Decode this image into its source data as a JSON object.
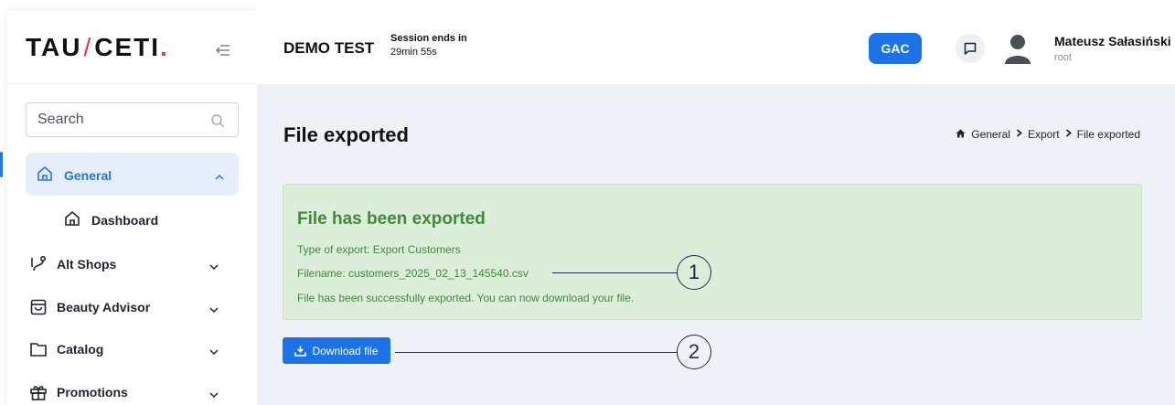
{
  "brand": {
    "logo_left": "TAU",
    "logo_slash": "/",
    "logo_right": "CETI",
    "logo_dot": "."
  },
  "sidebar": {
    "search_placeholder": "Search",
    "items": [
      {
        "label": "General",
        "icon": "home-icon",
        "expanded": true,
        "active": true
      },
      {
        "label": "Alt Shops",
        "icon": "branch-icon"
      },
      {
        "label": "Beauty Advisor",
        "icon": "calendar-bag-icon"
      },
      {
        "label": "Catalog",
        "icon": "folder-icon"
      },
      {
        "label": "Promotions",
        "icon": "gift-icon"
      }
    ],
    "sub_items": [
      {
        "label": "Dashboard",
        "icon": "home-icon"
      }
    ]
  },
  "header": {
    "app_title": "DEMO TEST",
    "session_label": "Session ends in",
    "session_time": "29min 55s",
    "gac_label": "GAC",
    "user_name": "Mateusz Sałasiński",
    "user_role": "root"
  },
  "main": {
    "page_title": "File exported",
    "breadcrumb": [
      "General",
      "Export",
      "File exported"
    ],
    "alert": {
      "title": "File has been exported",
      "type_line": "Type of export: Export Customers",
      "filename_line": "Filename: customers_2025_02_13_145540.csv",
      "message": "File has been successfully exported. You can now download your file."
    },
    "download_label": "Download file"
  },
  "callouts": [
    "1",
    "2"
  ],
  "colors": {
    "accent": "#1a73e8",
    "brand_red": "#e5354a",
    "success_text": "#3f8a3b",
    "success_bg": "#dcedd9",
    "main_bg": "#eef2f7"
  }
}
